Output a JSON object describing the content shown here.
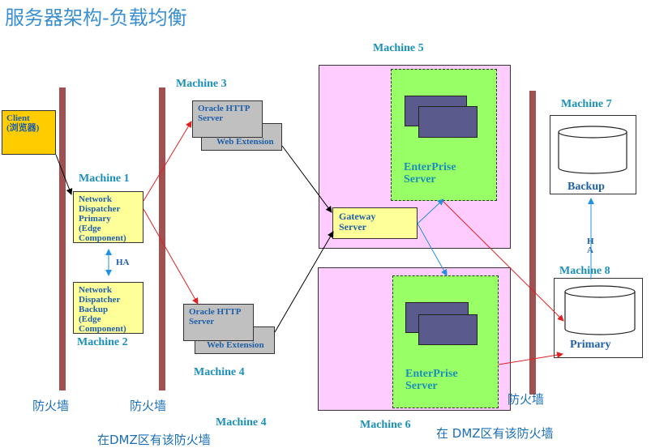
{
  "title": "服务器架构-负载均衡",
  "client": {
    "line1": "Client",
    "line2": "(浏览器)"
  },
  "machine_labels": {
    "m1": "Machine 1",
    "m2": "Machine 2",
    "m3": "Machine 3",
    "m4": "Machine 4",
    "m4b": "Machine 4",
    "m5": "Machine 5",
    "m6": "Machine 6",
    "m7": "Machine 7",
    "m8": "Machine 8"
  },
  "dispatcher_primary": [
    "Network",
    "Dispatcher",
    "Primary",
    "(Edge",
    "Component)"
  ],
  "dispatcher_backup": [
    "Network",
    "Dispatcher",
    "Backup",
    "(Edge",
    "Component)"
  ],
  "ha_label": "HA",
  "ha_vertical": [
    "H",
    "A"
  ],
  "http_server_top": {
    "line1": "Oracle HTTP",
    "line2": "Server",
    "ext": "Web Extension"
  },
  "http_server_bottom": {
    "line1": "Oracle HTTP",
    "line2": "Server",
    "ext": "Web Extension"
  },
  "gateway": {
    "line1": "Gateway",
    "line2": "Server"
  },
  "enterprise_top": {
    "line1": "EnterPrise",
    "line2": "Server"
  },
  "enterprise_bottom": {
    "line1": "EnterPrise",
    "line2": "Server"
  },
  "db_backup": {
    "name": "database",
    "role": "Backup"
  },
  "db_primary": {
    "name": "database",
    "role": "Primary"
  },
  "firewalls": {
    "f1": "防火墙",
    "f2": "防火墙",
    "f3": "防火墙"
  },
  "dmz_notes": {
    "left": "在DMZ区有该防火墙",
    "right": "在  DMZ区有该防火墙"
  },
  "colors": {
    "red_arrow": "#e02020",
    "blue_arrow": "#2090e0",
    "black_arrow": "#000000",
    "wall": "#a05050"
  }
}
